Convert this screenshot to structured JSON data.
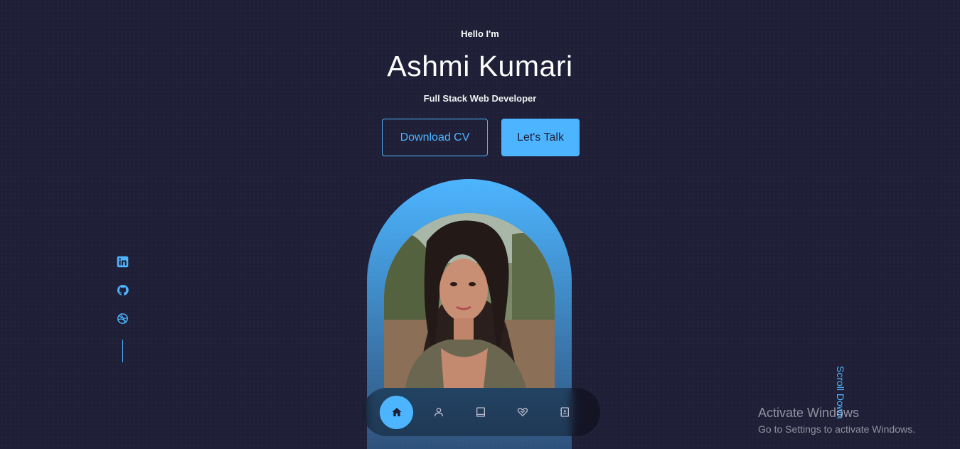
{
  "header": {
    "greeting": "Hello I'm",
    "name": "Ashmi Kumari",
    "role": "Full Stack Web Developer"
  },
  "cta": {
    "download_label": "Download CV",
    "talk_label": "Let's Talk"
  },
  "socials": [
    {
      "icon": "linkedin-icon"
    },
    {
      "icon": "github-icon"
    },
    {
      "icon": "dribbble-icon"
    }
  ],
  "scroll_label": "Scroll Down",
  "nav": [
    {
      "icon": "home-icon",
      "active": true
    },
    {
      "icon": "user-icon",
      "active": false
    },
    {
      "icon": "book-icon",
      "active": false
    },
    {
      "icon": "service-icon",
      "active": false
    },
    {
      "icon": "contact-icon",
      "active": false
    }
  ],
  "watermark": {
    "title": "Activate Windows",
    "subtitle": "Go to Settings to activate Windows."
  },
  "colors": {
    "background": "#1f1f38",
    "accent": "#4db5ff",
    "text": "#ffffff"
  }
}
